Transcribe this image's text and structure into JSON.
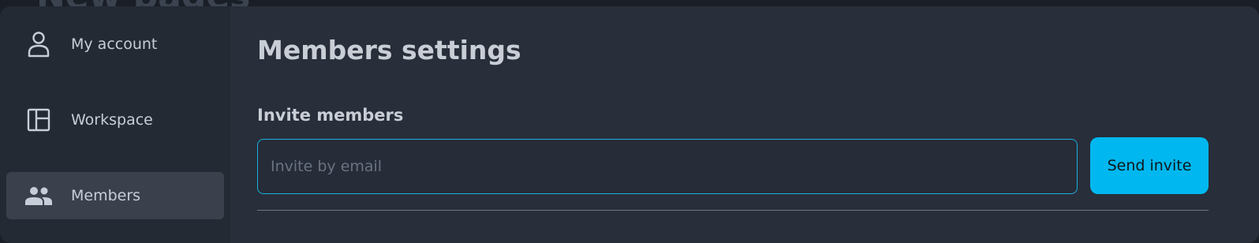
{
  "background": {
    "title": "New pages"
  },
  "sidebar": {
    "items": [
      {
        "label": "My account",
        "icon": "user-icon"
      },
      {
        "label": "Workspace",
        "icon": "layout-icon"
      },
      {
        "label": "Members",
        "icon": "users-icon",
        "active": true
      }
    ]
  },
  "main": {
    "title": "Members settings",
    "invite": {
      "label": "Invite members",
      "input_placeholder": "Invite by email",
      "input_value": "",
      "button_label": "Send invite"
    }
  },
  "colors": {
    "accent": "#00b8ef",
    "input_border": "#1ab0e0",
    "modal_bg": "#282e3a",
    "sidebar_bg": "#242a34",
    "active_item_bg": "#3a414d"
  }
}
